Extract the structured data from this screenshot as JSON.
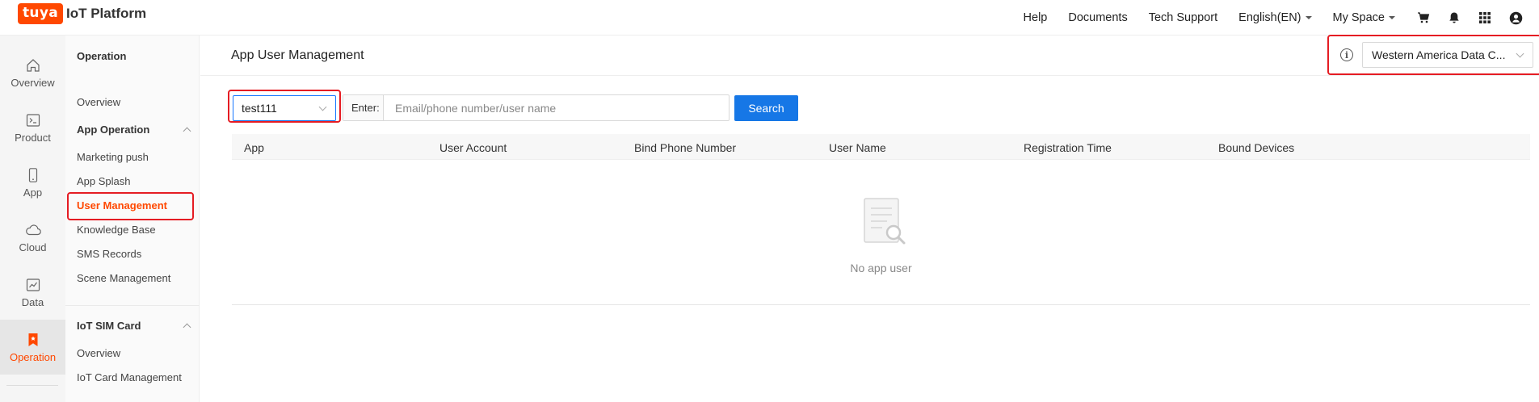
{
  "brand": {
    "logo": "tuya",
    "name": "IoT Platform"
  },
  "topnav": {
    "help": "Help",
    "documents": "Documents",
    "tech_support": "Tech Support",
    "language": "English(EN)",
    "my_space": "My Space",
    "icons": [
      "cart-icon",
      "bell-icon",
      "apps-grid-icon",
      "user-account-icon"
    ]
  },
  "rail": [
    {
      "label": "Overview",
      "icon": "home-icon"
    },
    {
      "label": "Product",
      "icon": "terminal-icon"
    },
    {
      "label": "App",
      "icon": "phone-icon"
    },
    {
      "label": "Cloud",
      "icon": "cloud-icon"
    },
    {
      "label": "Data",
      "icon": "chart-icon"
    },
    {
      "label": "Operation",
      "icon": "bookmark-icon",
      "active": true
    }
  ],
  "sidebar": {
    "title": "Operation",
    "overview": "Overview",
    "app_operation": "App Operation",
    "items": [
      "Marketing push",
      "App Splash",
      "User Management",
      "Knowledge Base",
      "SMS Records",
      "Scene Management"
    ],
    "iot_sim_card": "IoT SIM Card",
    "sim_items": [
      "Overview",
      "IoT Card Management"
    ]
  },
  "main": {
    "title": "App User Management",
    "region": "Western America Data C...",
    "app_select": "test111",
    "search_prefix": "Enter:",
    "search_placeholder": "Email/phone number/user name",
    "search_button": "Search",
    "columns": [
      "App",
      "User Account",
      "Bind Phone Number",
      "User Name",
      "Registration Time",
      "Bound Devices"
    ],
    "empty_text": "No app user"
  },
  "colors": {
    "accent": "#ff4800",
    "primary": "#1677e6",
    "highlight": "#e51c23"
  }
}
